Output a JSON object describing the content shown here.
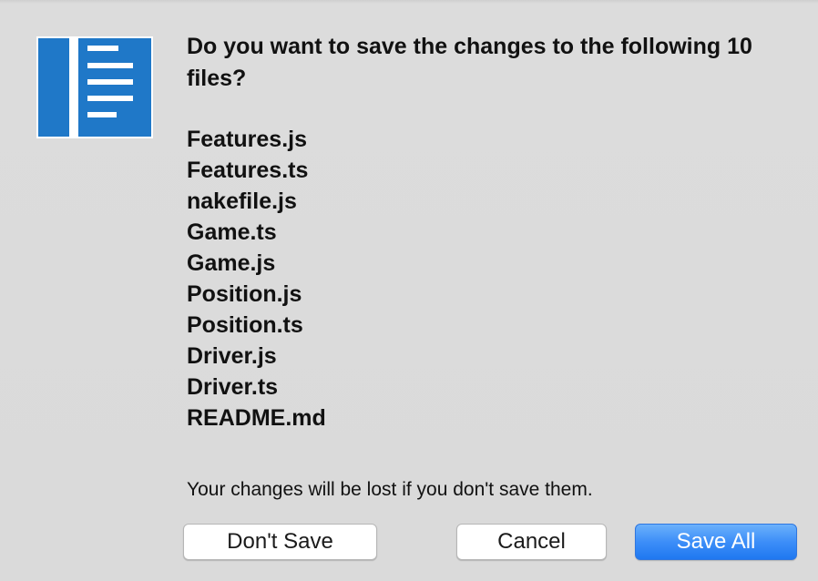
{
  "dialog": {
    "message": "Do you want to save the changes to the following 10 files?",
    "files": [
      "Features.js",
      "Features.ts",
      "nakefile.js",
      "Game.ts",
      "Game.js",
      "Position.js",
      "Position.ts",
      "Driver.js",
      "Driver.ts",
      "README.md"
    ],
    "info": "Your changes will be lost if you don't save them.",
    "icon": "document-lines-icon",
    "colors": {
      "icon_blue": "#1f78c8",
      "primary_button": "#3d8ef8",
      "background": "#dadada"
    }
  },
  "buttons": {
    "dont_save": "Don't Save",
    "cancel": "Cancel",
    "save_all": "Save All"
  }
}
